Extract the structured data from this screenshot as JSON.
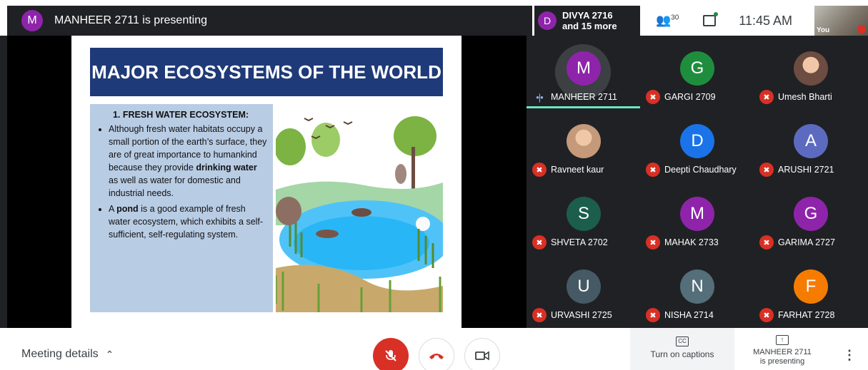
{
  "colors": {
    "purple": "#8e24aa",
    "green": "#1e8e3e",
    "blue": "#1a73e8",
    "indigo": "#5c6bc0",
    "teal": "#1b5e4b",
    "slate": "#455a64",
    "grey": "#546e7a",
    "orange": "#f57c00",
    "red": "#d93025"
  },
  "header": {
    "presenter_initial": "M",
    "presenter_text": "MANHEER 2711 is presenting",
    "other_initial": "D",
    "other_name": "DIVYA 2716",
    "other_more": "and 15 more",
    "people_count": "30",
    "time": "11:45 AM",
    "self_label": "You"
  },
  "slide": {
    "title": "MAJOR ECOSYSTEMS OF THE WORLD",
    "section_heading": "1. FRESH WATER ECOSYSTEM:",
    "bullet1_pre": "Although fresh water habitats occupy a small portion of the earth’s surface, they are of great importance to humankind because they provide ",
    "bullet1_bold": "drinking water",
    "bullet1_post": " as well as water for domestic and industrial needs.",
    "bullet2_pre": "A ",
    "bullet2_bold": "pond",
    "bullet2_post": " is a good example of fresh water ecosystem, which exhibits a self-sufficient, self-regulating system."
  },
  "participants": [
    {
      "initial": "M",
      "name": "MANHEER 2711",
      "color": "#8e24aa",
      "speaking": true
    },
    {
      "initial": "G",
      "name": "GARGI 2709",
      "color": "#1e8e3e"
    },
    {
      "initial": "",
      "name": "Umesh Bharti",
      "color": "#6d4c41",
      "photo": true
    },
    {
      "initial": "",
      "name": "Ravneet kaur",
      "color": "#c49a7a",
      "photo": true
    },
    {
      "initial": "D",
      "name": "Deepti Chaudhary",
      "color": "#1a73e8"
    },
    {
      "initial": "A",
      "name": "ARUSHI 2721",
      "color": "#5c6bc0"
    },
    {
      "initial": "S",
      "name": "SHVETA 2702",
      "color": "#1b5e4b"
    },
    {
      "initial": "M",
      "name": "MAHAK 2733",
      "color": "#8e24aa"
    },
    {
      "initial": "G",
      "name": "GARIMA 2727",
      "color": "#8e24aa"
    },
    {
      "initial": "U",
      "name": "URVASHI 2725",
      "color": "#455a64"
    },
    {
      "initial": "N",
      "name": "NISHA 2714",
      "color": "#546e7a"
    },
    {
      "initial": "F",
      "name": "FARHAT 2728",
      "color": "#f57c00"
    }
  ],
  "footer": {
    "meeting_details": "Meeting details",
    "captions_label": "Turn on captions",
    "presenting_name": "MANHEER 2711",
    "presenting_sub": "is presenting"
  }
}
